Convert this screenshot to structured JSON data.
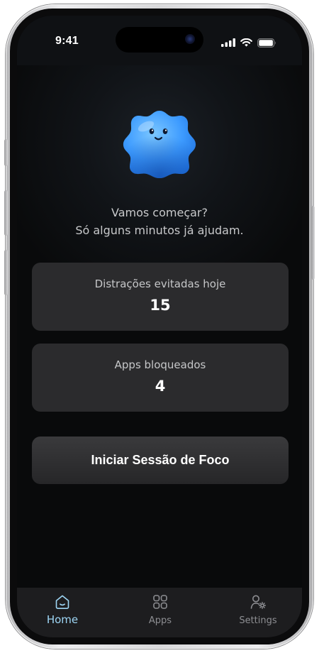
{
  "status_bar": {
    "time": "9:41",
    "icons": [
      "signal-icon",
      "wifi-icon",
      "battery-icon"
    ]
  },
  "mascot": {
    "icon": "smiling-blue-cloud-mascot",
    "color": "#3d9bff"
  },
  "intro": {
    "line1": "Vamos começar?",
    "line2": "Só alguns minutos já ajudam."
  },
  "stats": [
    {
      "label": "Distrações evitadas hoje",
      "value": "15"
    },
    {
      "label": "Apps bloqueados",
      "value": "4"
    }
  ],
  "cta": {
    "label": "Iniciar Sessão de Foco"
  },
  "tabbar": {
    "active_color": "#9ed6f5",
    "inactive_color": "#8d8e92",
    "items": [
      {
        "label": "Home",
        "icon": "home-icon",
        "active": true
      },
      {
        "label": "Apps",
        "icon": "grid-icon",
        "active": false
      },
      {
        "label": "Settings",
        "icon": "user-settings-icon",
        "active": false
      }
    ]
  }
}
